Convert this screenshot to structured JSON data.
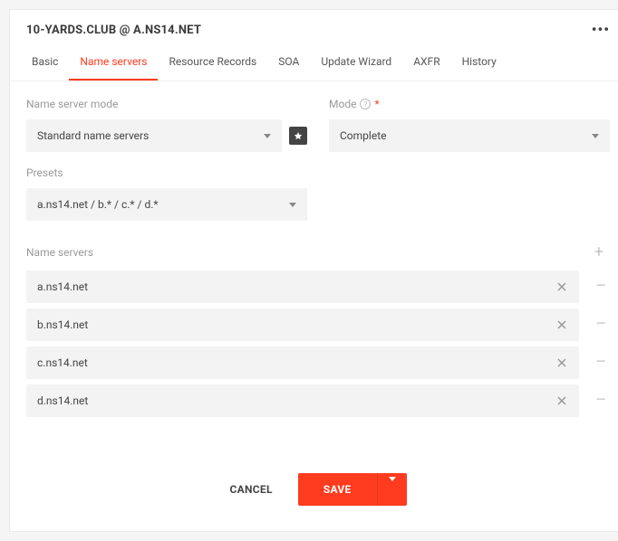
{
  "header": {
    "title": "10-YARDS.CLUB @ A.NS14.NET"
  },
  "tabs": [
    {
      "label": "Basic",
      "active": false
    },
    {
      "label": "Name servers",
      "active": true
    },
    {
      "label": "Resource Records",
      "active": false
    },
    {
      "label": "SOA",
      "active": false
    },
    {
      "label": "Update Wizard",
      "active": false
    },
    {
      "label": "AXFR",
      "active": false
    },
    {
      "label": "History",
      "active": false
    }
  ],
  "name_server_mode": {
    "label": "Name server mode",
    "value": "Standard name servers"
  },
  "mode": {
    "label": "Mode",
    "required_mark": "*",
    "value": "Complete"
  },
  "presets": {
    "label": "Presets",
    "value": "a.ns14.net / b.* / c.* / d.*"
  },
  "name_servers": {
    "label": "Name servers",
    "items": [
      {
        "value": "a.ns14.net"
      },
      {
        "value": "b.ns14.net"
      },
      {
        "value": "c.ns14.net"
      },
      {
        "value": "d.ns14.net"
      }
    ]
  },
  "footer": {
    "cancel": "CANCEL",
    "save": "SAVE"
  }
}
